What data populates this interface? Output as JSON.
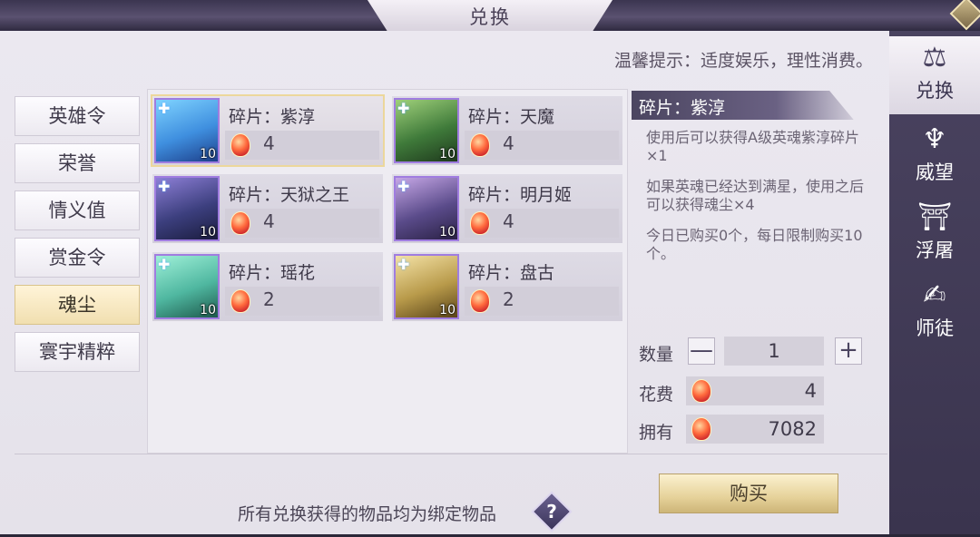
{
  "title": "兑换",
  "notice": "温馨提示：适度娱乐，理性消费。",
  "categories": [
    {
      "label": "英雄令",
      "active": false
    },
    {
      "label": "荣誉",
      "active": false
    },
    {
      "label": "情义值",
      "active": false
    },
    {
      "label": "赏金令",
      "active": false
    },
    {
      "label": "魂尘",
      "active": true
    },
    {
      "label": "寰宇精粹",
      "active": false
    }
  ],
  "items": [
    {
      "name": "碎片：紫淳",
      "cost": "4",
      "level": "10",
      "portrait_color": "#3f8fdf"
    },
    {
      "name": "碎片：天魔",
      "cost": "4",
      "level": "10",
      "portrait_color": "#3f7a3a"
    },
    {
      "name": "碎片：天狱之王",
      "cost": "4",
      "level": "10",
      "portrait_color": "#3c3f7e"
    },
    {
      "name": "碎片：明月姬",
      "cost": "4",
      "level": "10",
      "portrait_color": "#5a4b8a"
    },
    {
      "name": "碎片：瑶花",
      "cost": "2",
      "level": "10",
      "portrait_color": "#4fb7a0"
    },
    {
      "name": "碎片：盘古",
      "cost": "2",
      "level": "10",
      "portrait_color": "#b89a4a"
    }
  ],
  "detail": {
    "title": "碎片：紫淳",
    "desc1": "使用后可以获得A级英魂紫淳碎片×1",
    "desc2": "如果英魂已经达到满星，使用之后可以获得魂尘×4",
    "desc3": "今日已购买0个，每日限制购买10个。",
    "qty_label": "数量",
    "qty_value": "1",
    "minus": "—",
    "plus": "+",
    "cost_label": "花费",
    "cost_value": "4",
    "own_label": "拥有",
    "own_value": "7082"
  },
  "buy_label": "购买",
  "footnote": "所有兑换获得的物品均为绑定物品",
  "help": "?",
  "rail": [
    {
      "label": "兑换",
      "icon": "scales-icon",
      "glyph": "⚖",
      "active": true
    },
    {
      "label": "威望",
      "icon": "wings-icon",
      "glyph": "♆",
      "active": false
    },
    {
      "label": "浮屠",
      "icon": "pagoda-icon",
      "glyph": "⛩",
      "active": false
    },
    {
      "label": "师徒",
      "icon": "book-icon",
      "glyph": "✍",
      "active": false
    }
  ],
  "colors": {
    "accent": "#ecd79c",
    "rail": "#4a4360"
  }
}
